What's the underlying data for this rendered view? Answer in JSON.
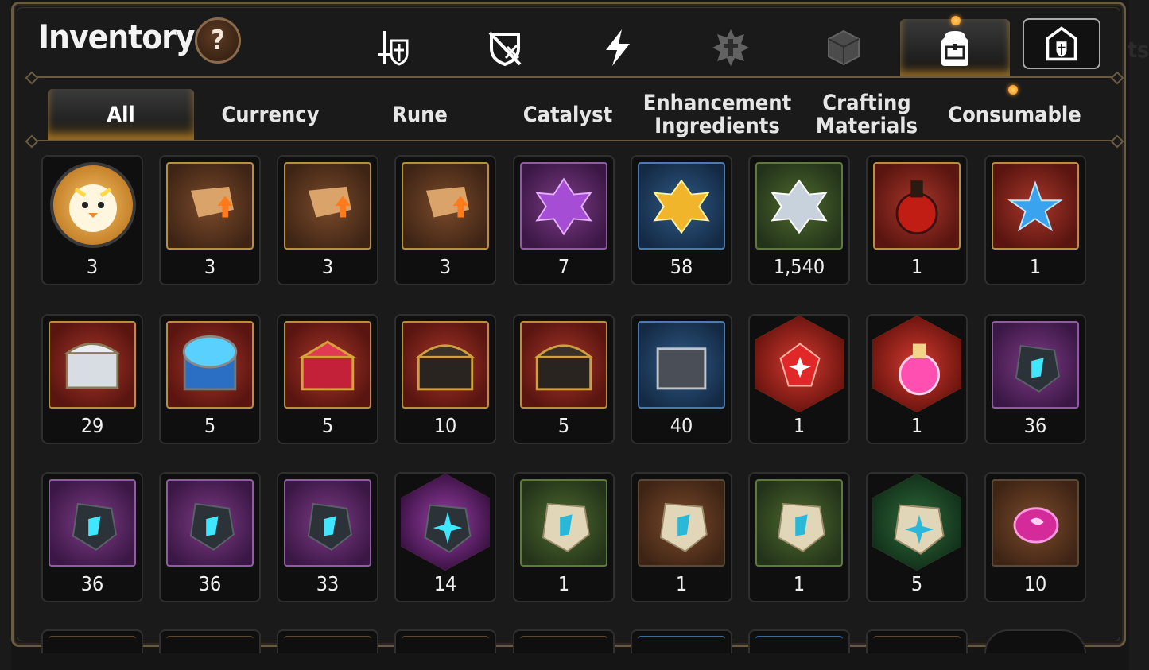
{
  "header": {
    "title": "Inventory",
    "help_label": "?"
  },
  "category_tabs": [
    {
      "icon": "sword-shield-icon",
      "active": false
    },
    {
      "icon": "no-armor-icon",
      "active": false
    },
    {
      "icon": "lightning-icon",
      "active": false
    },
    {
      "icon": "emblem-icon",
      "active": false,
      "dim": true
    },
    {
      "icon": "cube-icon",
      "active": false,
      "dim": true
    },
    {
      "icon": "backpack-icon",
      "active": true
    }
  ],
  "storage_icon": "castle-shield-icon",
  "sub_tabs": [
    {
      "label": "All",
      "active": true
    },
    {
      "label": "Currency"
    },
    {
      "label": "Rune"
    },
    {
      "label": "Catalyst"
    },
    {
      "label": "Enhancement\nIngredients"
    },
    {
      "label": "Crafting\nMaterials"
    },
    {
      "label": "Consumable"
    }
  ],
  "items": [
    {
      "name": "chick-medal",
      "count": "3"
    },
    {
      "name": "scroll-upgrade-red",
      "count": "3"
    },
    {
      "name": "scroll-upgrade-rainbow",
      "count": "3"
    },
    {
      "name": "scroll-upgrade-gold",
      "count": "3"
    },
    {
      "name": "purple-crystal-flower",
      "count": "7"
    },
    {
      "name": "gold-crystal-flower",
      "count": "58"
    },
    {
      "name": "silver-crystal-flower",
      "count": "1,540"
    },
    {
      "name": "red-potion-flask",
      "count": "1"
    },
    {
      "name": "blue-star-potion",
      "count": "1"
    },
    {
      "name": "silver-chest",
      "count": "29"
    },
    {
      "name": "blue-chest",
      "count": "5"
    },
    {
      "name": "red-chest",
      "count": "5"
    },
    {
      "name": "black-gold-chest",
      "count": "10"
    },
    {
      "name": "black-gold-chest-2",
      "count": "5"
    },
    {
      "name": "dark-silver-chest",
      "count": "40"
    },
    {
      "name": "red-ruby-hex",
      "count": "1"
    },
    {
      "name": "pink-potion-hex",
      "count": "1"
    },
    {
      "name": "cyan-rune-sword",
      "count": "36"
    },
    {
      "name": "cyan-rune-helmet",
      "count": "36"
    },
    {
      "name": "cyan-rune-armor",
      "count": "36"
    },
    {
      "name": "cyan-rune-boots",
      "count": "33"
    },
    {
      "name": "star-rune-hex",
      "count": "14"
    },
    {
      "name": "stone-rune-sword",
      "count": "1"
    },
    {
      "name": "stone-rune-helmet",
      "count": "1"
    },
    {
      "name": "stone-rune-boots",
      "count": "1"
    },
    {
      "name": "stone-star-hex",
      "count": "5"
    },
    {
      "name": "pink-gem",
      "count": "10"
    }
  ],
  "colors": {
    "accent": "#e2a33a",
    "frame": "#6a5a41"
  }
}
